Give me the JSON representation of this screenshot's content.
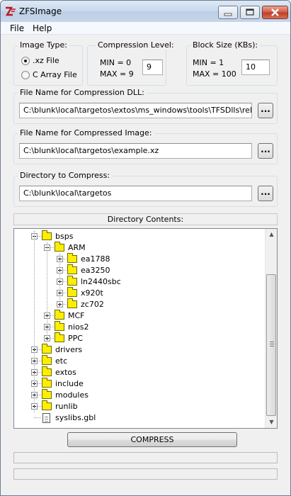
{
  "window": {
    "title": "ZFSImage"
  },
  "menu": [
    {
      "label": "File"
    },
    {
      "label": "Help"
    }
  ],
  "image_type": {
    "legend": "Image Type:",
    "options": [
      {
        "label": ".xz File",
        "selected": true
      },
      {
        "label": "C Array File",
        "selected": false
      }
    ]
  },
  "compression": {
    "legend": "Compression Level:",
    "min": "MIN = 0",
    "max": "MAX = 9",
    "value": "9"
  },
  "block_size": {
    "legend": "Block Size (KBs):",
    "min": "MIN = 1",
    "max": "MAX = 100",
    "value": "10"
  },
  "dll_path": {
    "legend": "File Name for Compression DLL:",
    "value": "C:\\blunk\\local\\targetos\\extos\\ms_windows\\tools\\TFSDlls\\release\\zf",
    "browse": "..."
  },
  "image_path": {
    "legend": "File Name for Compressed Image:",
    "value": "C:\\blunk\\local\\targetos\\example.xz",
    "browse": "..."
  },
  "dir_path": {
    "legend": "Directory to Compress:",
    "value": "C:\\blunk\\local\\targetos",
    "browse": "..."
  },
  "contents_header": "Directory Contents:",
  "tree": [
    {
      "label": "bsps",
      "depth": 0,
      "type": "folder",
      "expander": "minus"
    },
    {
      "label": "ARM",
      "depth": 1,
      "type": "folder",
      "expander": "minus"
    },
    {
      "label": "ea1788",
      "depth": 2,
      "type": "folder",
      "expander": "plus"
    },
    {
      "label": "ea3250",
      "depth": 2,
      "type": "folder",
      "expander": "plus"
    },
    {
      "label": "ln2440sbc",
      "depth": 2,
      "type": "folder",
      "expander": "plus"
    },
    {
      "label": "x920t",
      "depth": 2,
      "type": "folder",
      "expander": "plus"
    },
    {
      "label": "zc702",
      "depth": 2,
      "type": "folder",
      "expander": "plus"
    },
    {
      "label": "MCF",
      "depth": 1,
      "type": "folder",
      "expander": "plus"
    },
    {
      "label": "nios2",
      "depth": 1,
      "type": "folder",
      "expander": "plus"
    },
    {
      "label": "PPC",
      "depth": 1,
      "type": "folder",
      "expander": "plus"
    },
    {
      "label": "drivers",
      "depth": 0,
      "type": "folder",
      "expander": "plus"
    },
    {
      "label": "etc",
      "depth": 0,
      "type": "folder",
      "expander": "plus"
    },
    {
      "label": "extos",
      "depth": 0,
      "type": "folder",
      "expander": "plus"
    },
    {
      "label": "include",
      "depth": 0,
      "type": "folder",
      "expander": "plus"
    },
    {
      "label": "modules",
      "depth": 0,
      "type": "folder",
      "expander": "plus"
    },
    {
      "label": "runlib",
      "depth": 0,
      "type": "folder",
      "expander": "plus"
    },
    {
      "label": "syslibs.gbl",
      "depth": 0,
      "type": "file",
      "expander": "none"
    }
  ],
  "compress_button": "COMPRESS",
  "colors": {
    "folder": "#ffee00",
    "titlebar": "#c8d8ec",
    "close_button": "#c03a26"
  }
}
